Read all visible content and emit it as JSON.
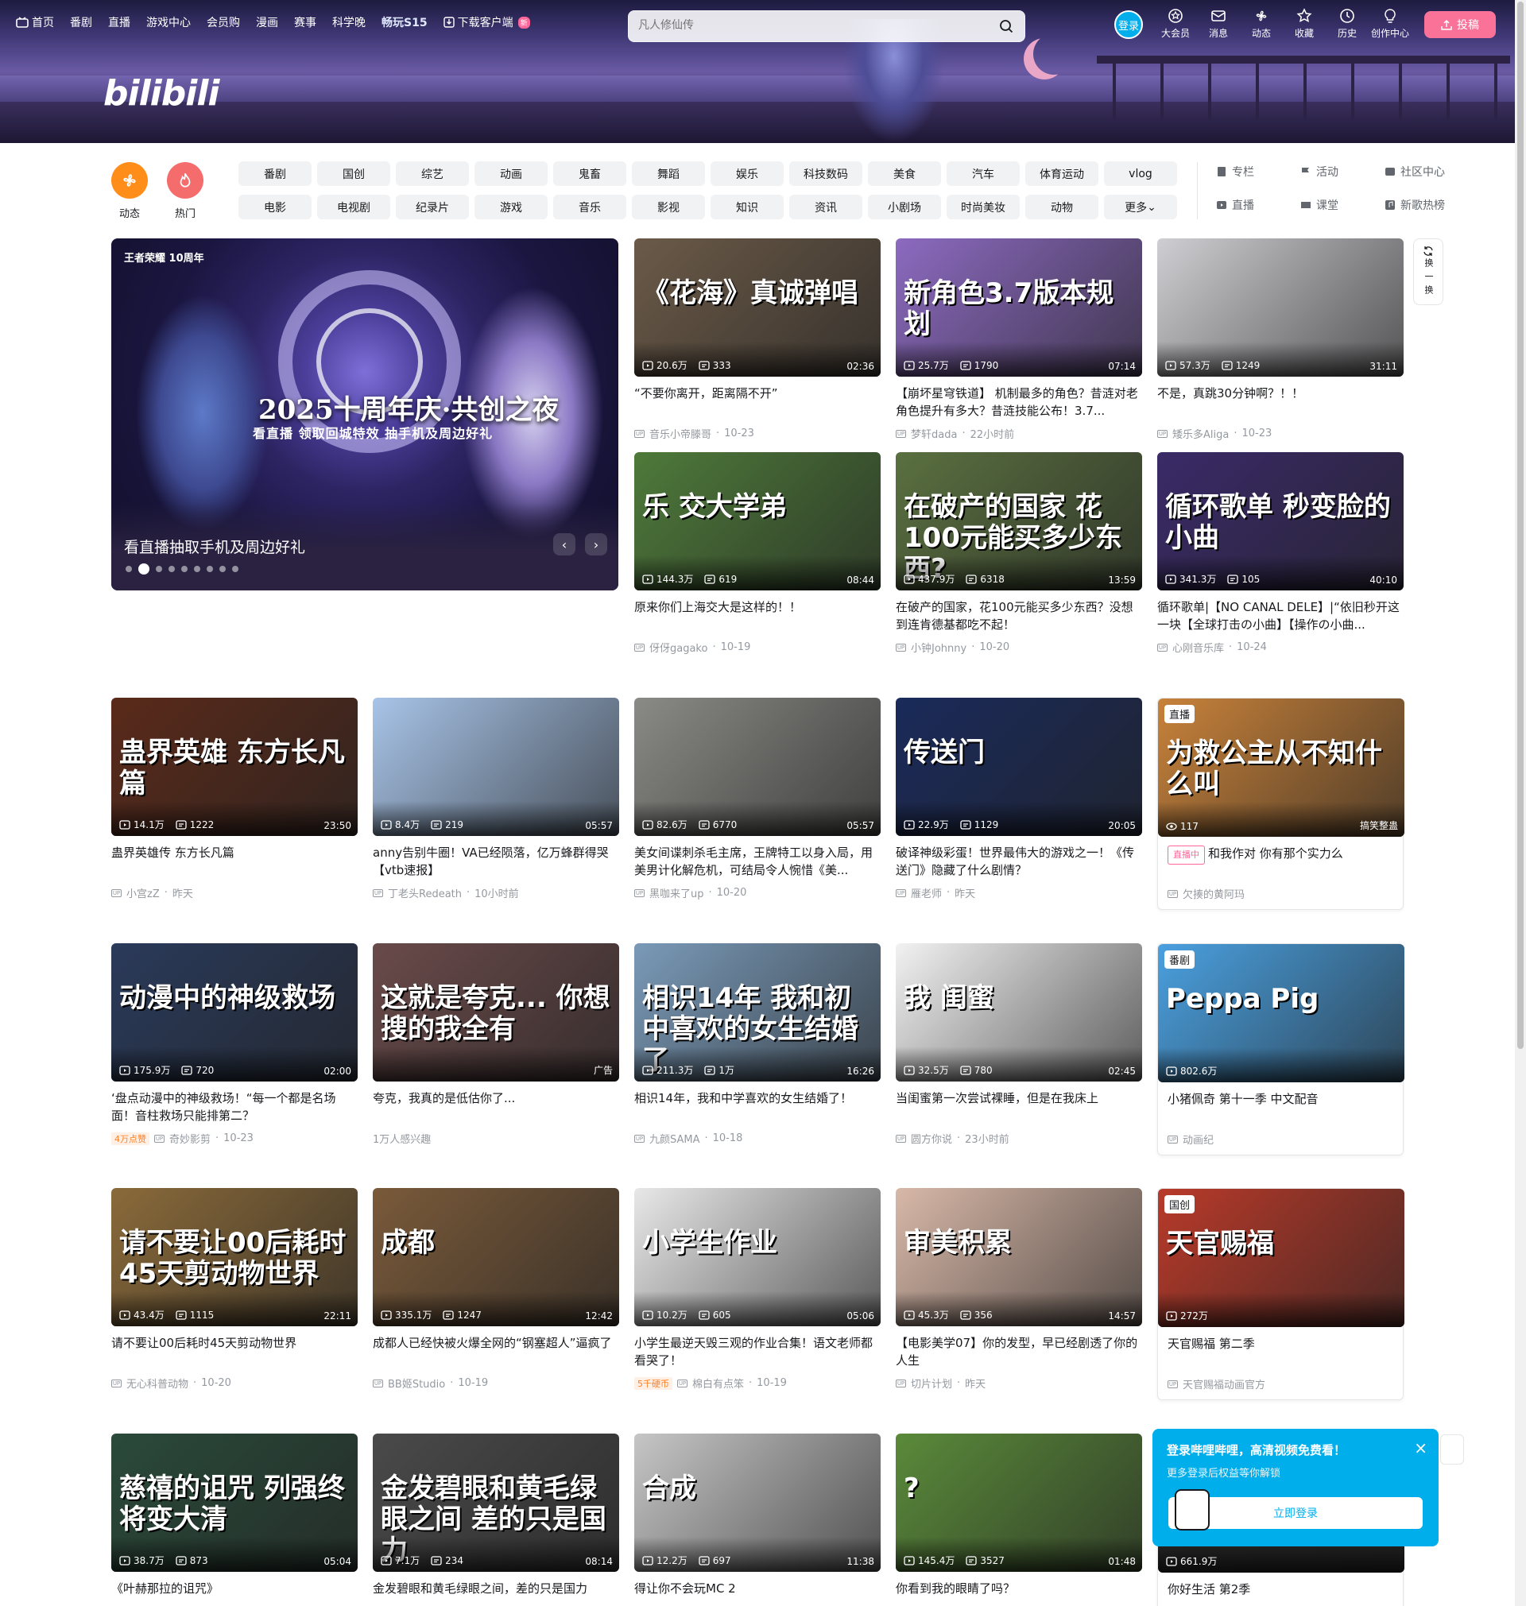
{
  "nav": {
    "items": [
      "首页",
      "番剧",
      "直播",
      "游戏中心",
      "会员购",
      "漫画",
      "赛事",
      "科学晚",
      "畅玩S15",
      "下载客户端"
    ],
    "new_badge": "新",
    "search_placeholder": "凡人修仙传",
    "login": "登录",
    "right": [
      "大会员",
      "消息",
      "动态",
      "收藏",
      "历史",
      "创作中心"
    ],
    "upload": "投稿"
  },
  "logo": "bilibili",
  "channels": {
    "dynamic": "动态",
    "hot": "热门",
    "chips": [
      "番剧",
      "国创",
      "综艺",
      "动画",
      "鬼畜",
      "舞蹈",
      "娱乐",
      "科技数码",
      "美食",
      "汽车",
      "体育运动",
      "vlog",
      "电影",
      "电视剧",
      "纪录片",
      "游戏",
      "音乐",
      "影视",
      "知识",
      "资讯",
      "小剧场",
      "时尚美妆",
      "动物",
      "更多"
    ],
    "right": [
      "专栏",
      "活动",
      "社区中心",
      "直播",
      "课堂",
      "新歌热榜"
    ]
  },
  "carousel": {
    "brand": "王者荣耀 10周年",
    "headline": "2025十周年庆·共创之夜",
    "subline": "看直播 领取回城特效 抽手机及周边好礼",
    "caption": "看直播抽取手机及周边好礼",
    "dots": 9,
    "active": 1
  },
  "refresh": "换一换",
  "popup": {
    "title": "登录哔哩哔哩，高清视频免费看！",
    "subtitle": "更多登录后权益等你解锁",
    "button": "立即登录"
  },
  "colors": {
    "accent": "#fb7299",
    "blue": "#00aeec",
    "orange": "#ff8d1a",
    "hot": "#f56c6c"
  },
  "cards": [
    {
      "thumb_text": "《花海》真诚弹唱",
      "bg": "#6b5a48",
      "views": "20.6万",
      "danmaku": "333",
      "duration": "02:36",
      "title": "“不要你离开，距离隔不开”",
      "up": "音乐小帝滕哥",
      "date": "10-23"
    },
    {
      "thumb_text": "新角色3.7版本规划",
      "bg": "#8c6ac0",
      "views": "25.7万",
      "danmaku": "1790",
      "duration": "07:14",
      "title": "【崩坏星穹铁道】 机制最多的角色？昔涟对老角色提升有多大？昔涟技能公布！3.7...",
      "up": "梦轩dada",
      "date": "22小时前"
    },
    {
      "thumb_text": "",
      "bg": "#cfcfd3",
      "views": "57.3万",
      "danmaku": "1249",
      "duration": "31:11",
      "title": "不是，真跳30分钟啊？！！",
      "up": "矮乐多Aliga",
      "date": "10-23"
    },
    {
      "thumb_text": "乐 交大学弟",
      "bg": "#4e7a3a",
      "views": "144.3万",
      "danmaku": "619",
      "duration": "08:44",
      "title": "原来你们上海交大是这样的！！",
      "up": "伢伢gagako",
      "date": "10-19"
    },
    {
      "thumb_text": "在破产的国家 花100元能买多少东西?",
      "bg": "#5a7040",
      "views": "437.9万",
      "danmaku": "6318",
      "duration": "13:59",
      "title": "在破产的国家，花100元能买多少东西？没想到连肯德基都吃不起！",
      "up": "小钟Johnny",
      "date": "10-20"
    },
    {
      "thumb_text": "循环歌单 秒变脸的小曲",
      "bg": "#3a2a68",
      "views": "341.3万",
      "danmaku": "105",
      "duration": "40:10",
      "title": "循环歌单|【NO CANAL DELE】|“依旧秒开这一块【全球打击の小曲】【操作の小曲...",
      "up": "心刚音乐库",
      "date": "10-24"
    },
    {
      "thumb_text": "蛊界英雄 东方长凡篇",
      "bg": "#5a2a1a",
      "views": "14.1万",
      "danmaku": "1222",
      "duration": "23:50",
      "title": "蛊界英雄传 东方长凡篇",
      "up": "小宫zZ",
      "date": "昨天"
    },
    {
      "thumb_text": "",
      "bg": "#a8c4e8",
      "views": "8.4万",
      "danmaku": "219",
      "duration": "05:57",
      "title": "anny告别牛圈！VA已经陨落，亿万蜂群得哭【vtb速报】",
      "up": "丁老头Redeath",
      "date": "10小时前"
    },
    {
      "thumb_text": "",
      "bg": "#8a8a86",
      "views": "82.6万",
      "danmaku": "6770",
      "duration": "05:57",
      "title": "美女间谍刺杀毛主席，王牌特工以身入局，用美男计化解危机，可结局令人惋惜《美...",
      "up": "黑咖来了up",
      "date": "10-20"
    },
    {
      "thumb_text": "传送门",
      "bg": "#1a2a5a",
      "views": "22.9万",
      "danmaku": "1129",
      "duration": "20:05",
      "title": "破译神级彩蛋！世界最伟大的游戏之一！《传送门》隐藏了什么剧情？",
      "up": "雁老师",
      "date": "昨天"
    },
    {
      "thumb_text": "为救公主从不知什么叫",
      "bg": "#c8823a",
      "views": "117",
      "danmaku": "",
      "duration": "搞笑整蛊",
      "title": "和我作对 你有那个实力么",
      "up": "欠揍的黄阿玛",
      "date": "",
      "live": "直播中",
      "tag": "直播",
      "boxed": true
    },
    {
      "thumb_text": "动漫中的神级救场",
      "bg": "#2a3a5a",
      "views": "175.9万",
      "danmaku": "720",
      "duration": "02:00",
      "title": "‘盘点动漫中的神级救场！“每一个都是名场面！音柱救场只能排第二？",
      "up": "奇妙影剪",
      "date": "10-23",
      "flag": "4万点赞"
    },
    {
      "thumb_text": "这就是夸克... 你想搜的我全有",
      "bg": "#6a4a4a",
      "views": "",
      "danmaku": "",
      "duration": "广告",
      "title": "夸克，我真的是低估你了...",
      "up": "1万人感兴趣",
      "date": "",
      "ad": true
    },
    {
      "thumb_text": "相识14年 我和初中喜欢的女生结婚了",
      "bg": "#7a9ab8",
      "views": "211.3万",
      "danmaku": "1万",
      "duration": "16:26",
      "title": "相识14年，我和中学喜欢的女生结婚了！",
      "up": "九颜SAMA",
      "date": "10-18"
    },
    {
      "thumb_text": "我 闺蜜",
      "bg": "#f2f2f2",
      "views": "32.5万",
      "danmaku": "780",
      "duration": "02:45",
      "title": "当闺蜜第一次尝试裸睡，但是在我床上",
      "up": "圆方你说",
      "date": "23小时前"
    },
    {
      "thumb_text": "Peppa Pig",
      "bg": "#4aa0e0",
      "views": "802.6万",
      "danmaku": "",
      "duration": "",
      "title": "小猪佩奇 第十一季 中文配音",
      "up": "动画纪",
      "date": "",
      "tag": "番剧",
      "boxed": true
    },
    {
      "thumb_text": "请不要让00后耗时45天剪动物世界",
      "bg": "#8a6a3a",
      "views": "43.4万",
      "danmaku": "1115",
      "duration": "22:11",
      "title": "请不要让00后耗时45天剪动物世界",
      "up": "无心科普动物",
      "date": "10-20"
    },
    {
      "thumb_text": "成都",
      "bg": "#7a5a3a",
      "views": "335.1万",
      "danmaku": "1247",
      "duration": "12:42",
      "title": "成都人已经快被火爆全网的“钢塞超人”逼疯了",
      "up": "BB姬Studio",
      "date": "10-19"
    },
    {
      "thumb_text": "小学生作业",
      "bg": "#e8e8e8",
      "views": "10.2万",
      "danmaku": "605",
      "duration": "05:06",
      "title": "小学生最逆天毁三观的作业合集！语文老师都看哭了！",
      "up": "棉白有点笨",
      "date": "10-19",
      "flag": "5千硬币"
    },
    {
      "thumb_text": "审美积累",
      "bg": "#d8b8a8",
      "views": "45.3万",
      "danmaku": "356",
      "duration": "14:57",
      "title": "【电影美学07】你的发型，早已经剧透了你的人生",
      "up": "切片计划",
      "date": "昨天"
    },
    {
      "thumb_text": "天官赐福",
      "bg": "#b83a2a",
      "views": "272万",
      "danmaku": "",
      "duration": "",
      "title": "天官赐福 第二季",
      "up": "天官赐福动画官方",
      "date": "",
      "tag": "国创",
      "boxed": true
    },
    {
      "thumb_text": "慈禧的诅咒 列强终将变大清",
      "bg": "#2a4a3a",
      "views": "38.7万",
      "danmaku": "873",
      "duration": "05:04",
      "title": "《叶赫那拉的诅咒》",
      "up": "",
      "date": ""
    },
    {
      "thumb_text": "金发碧眼和黄毛绿眼之间 差的只是国力",
      "bg": "#4a4a4a",
      "views": "7.1万",
      "danmaku": "234",
      "duration": "08:14",
      "title": "金发碧眼和黄毛绿眼之间，差的只是国力",
      "up": "",
      "date": ""
    },
    {
      "thumb_text": "合成",
      "bg": "#c6c6c6",
      "views": "12.2万",
      "danmaku": "697",
      "duration": "11:38",
      "title": "得让你不会玩MC 2",
      "up": "",
      "date": ""
    },
    {
      "thumb_text": "?",
      "bg": "#5a8a3a",
      "views": "145.4万",
      "danmaku": "3527",
      "duration": "01:48",
      "title": "你看到我的眼睛了吗？",
      "up": "",
      "date": ""
    },
    {
      "thumb_text": "",
      "bg": "#2a2a2a",
      "views": "661.9万",
      "danmaku": "",
      "duration": "",
      "title": "你好生活 第2季",
      "up": "",
      "date": "",
      "boxed": true
    }
  ]
}
